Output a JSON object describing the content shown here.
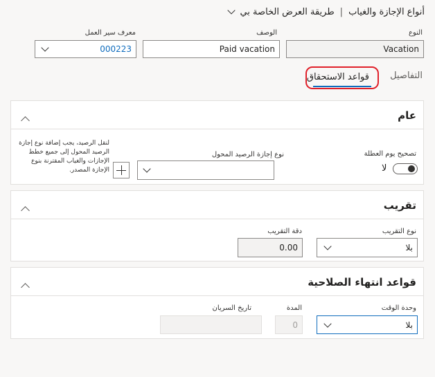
{
  "breadcrumb": {
    "part1": "أنواع الإجازة والغياب",
    "separator": "|",
    "part2": "طريقة العرض الخاصة بي"
  },
  "header_fields": {
    "type_label": "النوع",
    "type_value": "Vacation",
    "description_label": "الوصف",
    "description_value": "Paid vacation",
    "workflow_label": "معرف سير العمل",
    "workflow_value": "000223"
  },
  "tabs": {
    "accrual_rules": "قواعد الاستحقاق",
    "details": "التفاصيل"
  },
  "general": {
    "title": "عام",
    "holiday_label": "تصحيح يوم العطلة",
    "holiday_value": "لا",
    "transfer_label": "نوع إجازة الرصيد المحول",
    "transfer_value": "",
    "hint": "لنقل الرصيد، يجب إضافة نوع إجازة الرصيد المحول إلى جميع خطط الإجازات والغياب المقترنة بنوع الإجازة المصدر."
  },
  "rounding": {
    "title": "تقريب",
    "type_label": "نوع التقريب",
    "type_value": "بلا",
    "precision_label": "دقة التقريب",
    "precision_value": "0.00"
  },
  "expiration": {
    "title": "قواعد انتهاء الصلاحية",
    "unit_label": "وحدة الوقت",
    "unit_value": "بلا",
    "duration_label": "المدة",
    "duration_value": "0",
    "effective_label": "تاريخ السريان",
    "effective_value": ""
  },
  "colors": {
    "accent": "#0f6cbd",
    "highlight_circle": "#e0202a",
    "page_bg": "#f8f7f6"
  }
}
